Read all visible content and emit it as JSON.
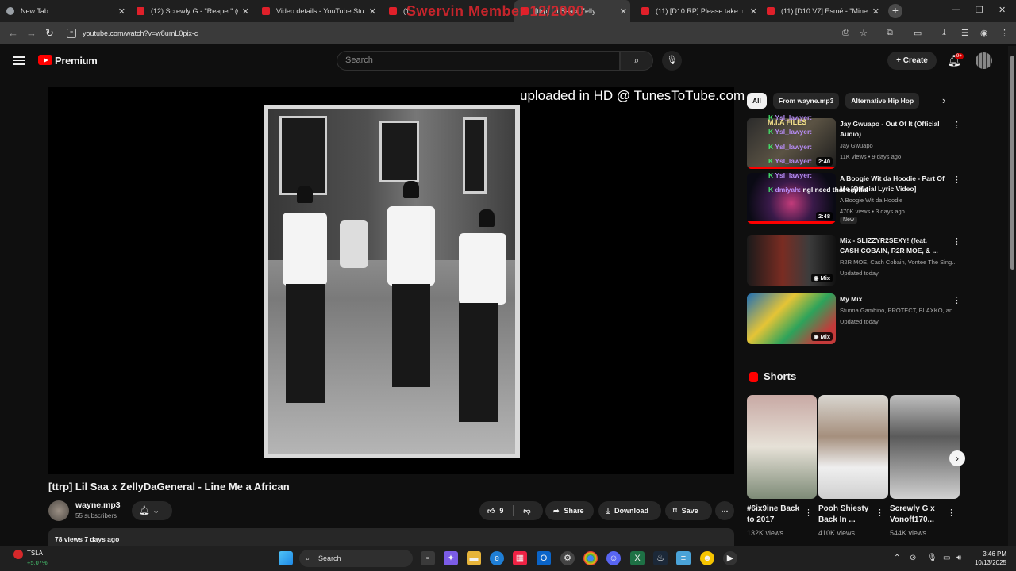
{
  "browser": {
    "tabs": [
      {
        "title": "New Tab",
        "favicon": "chrome-icon"
      },
      {
        "title": "(12) Screwly G - \"Reaper\" (Offic",
        "favicon": "youtube-icon"
      },
      {
        "title": "Video details - YouTube Studio",
        "favicon": "youtube-icon"
      },
      {
        "title": "(1",
        "favicon": "youtube-icon"
      },
      {
        "title": "[ttrp] Lil Saa x Zelly",
        "favicon": "youtube-icon"
      },
      {
        "title": "(11) [D10:RP] Please take me ba",
        "favicon": "youtube-icon"
      },
      {
        "title": "(11) [D10 V7] Esmé - \"Mine\" | G",
        "favicon": "youtube-icon"
      }
    ],
    "overlay_text": "Swervin Member 12/2000",
    "url": "youtube.com/watch?v=w8umL0pix-c"
  },
  "header": {
    "brand": "Premium",
    "search_placeholder": "Search",
    "create_label": "Create",
    "notifications_badge": "9+"
  },
  "video": {
    "overlay_text": "uploaded in HD @ TunesToTube.com",
    "title": "[ttrp] Lil Saa x ZellyDaGeneral - Line Me a African",
    "channel": "wayne.mp3",
    "subscribers": "55 subscribers",
    "likes": "9",
    "share_label": "Share",
    "download_label": "Download",
    "save_label": "Save",
    "stats": "78 views  7 days ago"
  },
  "sidebar": {
    "chips": [
      "All",
      "From wayne.mp3",
      "Alternative Hip Hop"
    ],
    "recs": [
      {
        "title": "Jay Gwuapo - Out Of It (Official Audio)",
        "channel": "Jay Gwuapo",
        "meta": "11K views • 9 days ago",
        "duration": "2:40"
      },
      {
        "title": "A Boogie Wit da Hoodie - Part Of Me [Official Lyric Video]",
        "channel": "A Boogie Wit da Hoodie",
        "meta": "470K views • 3 days ago",
        "duration": "2:48",
        "badge": "New"
      },
      {
        "title": "Mix - SLIZZYR2SEXY! (feat. CASH COBAIN, R2R MOE, & ...",
        "channel": "R2R MOE, Cash Cobain, Vontee The Sing...",
        "meta": "Updated today",
        "duration": "Mix"
      },
      {
        "title": "My Mix",
        "channel": "Stunna Gambino, PROTECT, BLAXKO, an...",
        "meta": "Updated today",
        "duration": "Mix"
      }
    ],
    "chat_overlay": [
      {
        "user": "Ysl_lawyer:",
        "text": ""
      },
      {
        "user": "Ysl_lawyer:",
        "text": ""
      },
      {
        "user": "Ysl_lawyer:",
        "text": ""
      },
      {
        "user": "Ysl_lawyer:",
        "text": ""
      },
      {
        "user": "Ysl_lawyer:",
        "text": ""
      },
      {
        "user": "dmiyah:",
        "text": "ngl need that capital"
      }
    ],
    "thumb_text": "M.I.A FILES",
    "shorts_title": "Shorts",
    "shorts": [
      {
        "title": "#6ix9ine Back to 2017",
        "views": "132K views"
      },
      {
        "title": "Pooh Shiesty Back In ...",
        "views": "410K views"
      },
      {
        "title": "Screwly G x Vonoff170...",
        "views": "544K views"
      }
    ]
  },
  "taskbar": {
    "ticker": "TSLA",
    "ticker_change": "+5.07%",
    "search_label": "Search",
    "time": "3:46 PM",
    "date": "10/13/2025"
  },
  "colors": {
    "accent": "#ff0000",
    "bg": "#0f0f0f",
    "chip_bg": "#272727"
  }
}
